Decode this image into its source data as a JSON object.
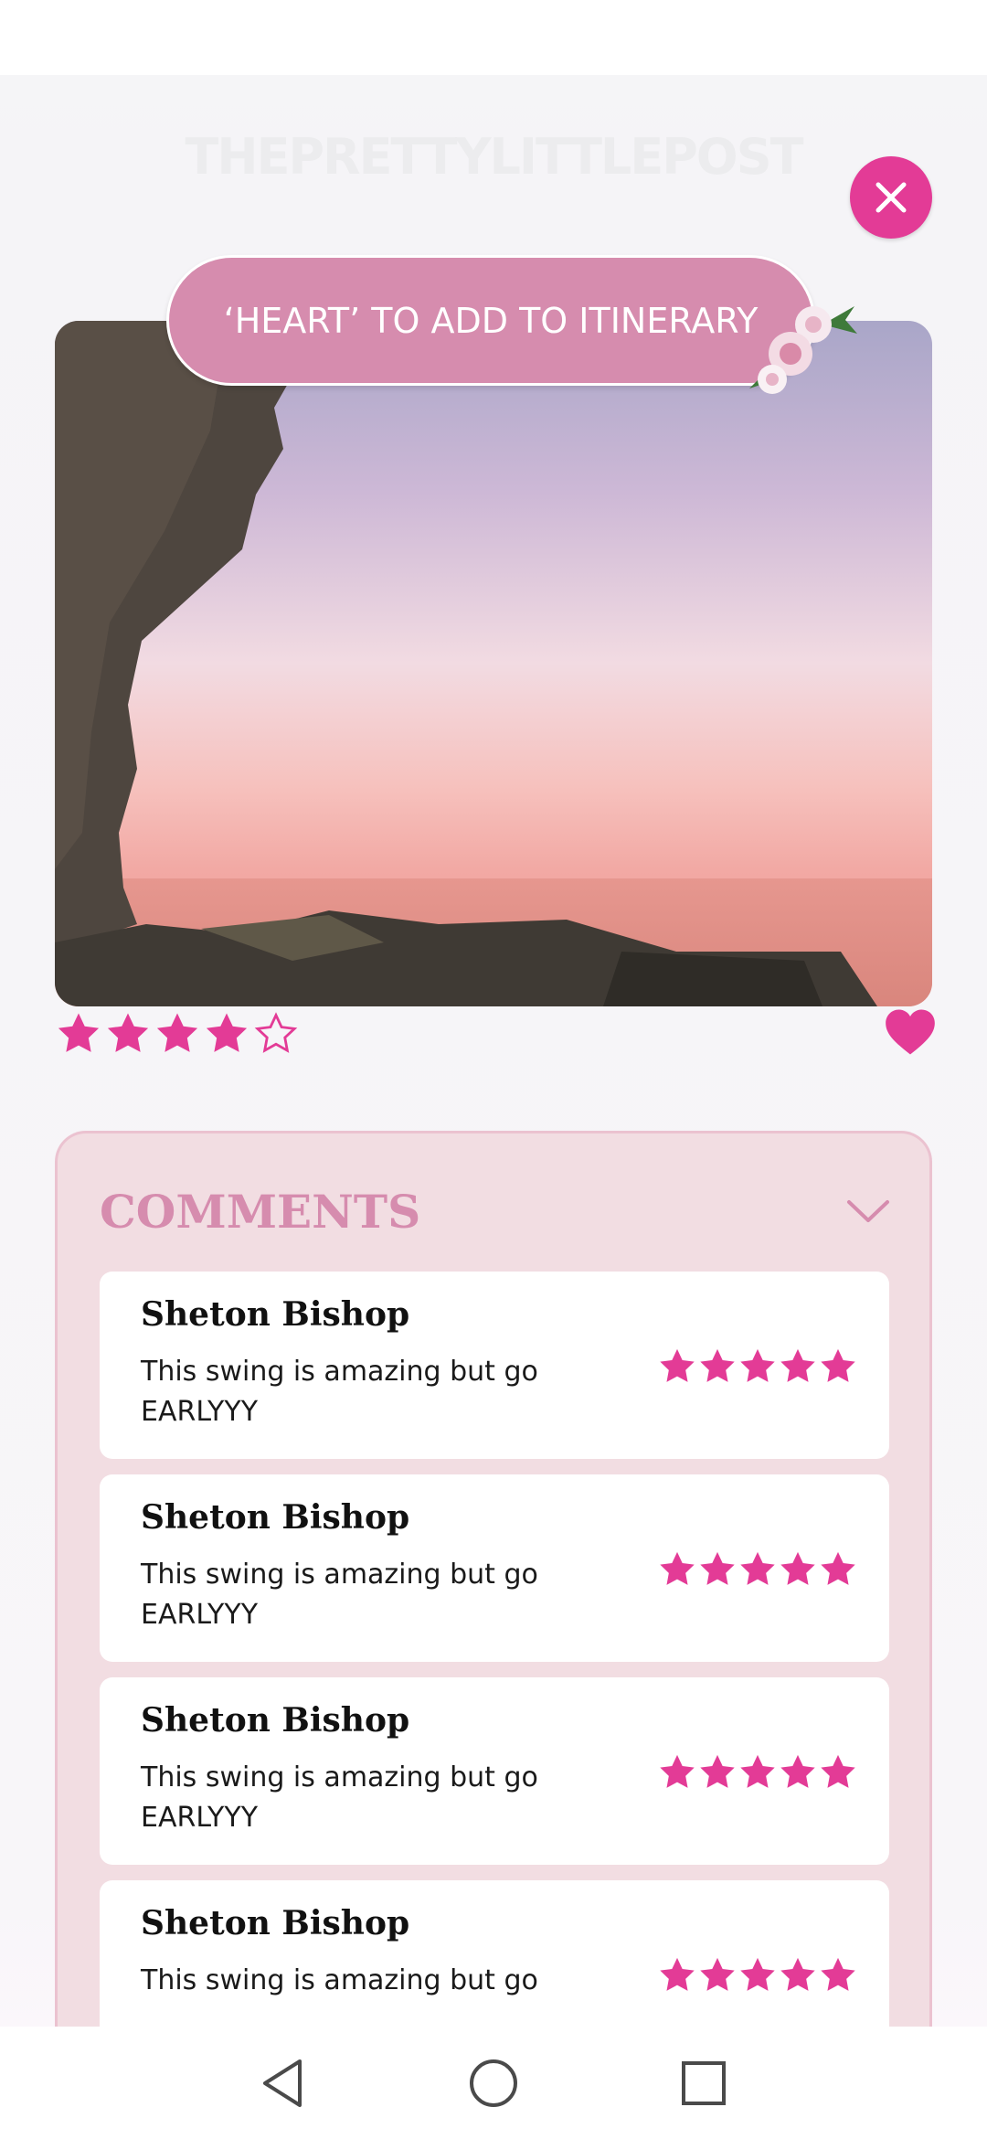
{
  "header": {
    "logo_text": "THEPRETTYLITTLEPOST"
  },
  "banner": {
    "label": "‘HEART’ TO ADD TO ITINERARY"
  },
  "rating": {
    "value": 4,
    "max": 5
  },
  "comments": {
    "title": "COMMENTS",
    "items": [
      {
        "name": "Sheton Bishop",
        "text": "This swing is amazing but go EARLYYY",
        "stars": 5
      },
      {
        "name": "Sheton Bishop",
        "text": "This swing is amazing but go EARLYYY",
        "stars": 5
      },
      {
        "name": "Sheton Bishop",
        "text": "This swing is amazing but go EARLYYY",
        "stars": 5
      },
      {
        "name": "Sheton Bishop",
        "text": "This swing is amazing but go",
        "stars": 5
      }
    ]
  },
  "colors": {
    "accent_pink": "#e33b96",
    "banner_pink": "#d68cae",
    "panel_bg": "#f2dde2"
  },
  "icons": [
    "close-icon",
    "heart-icon",
    "chevron-down-icon",
    "star-icon",
    "back-icon",
    "home-icon",
    "recents-icon"
  ]
}
